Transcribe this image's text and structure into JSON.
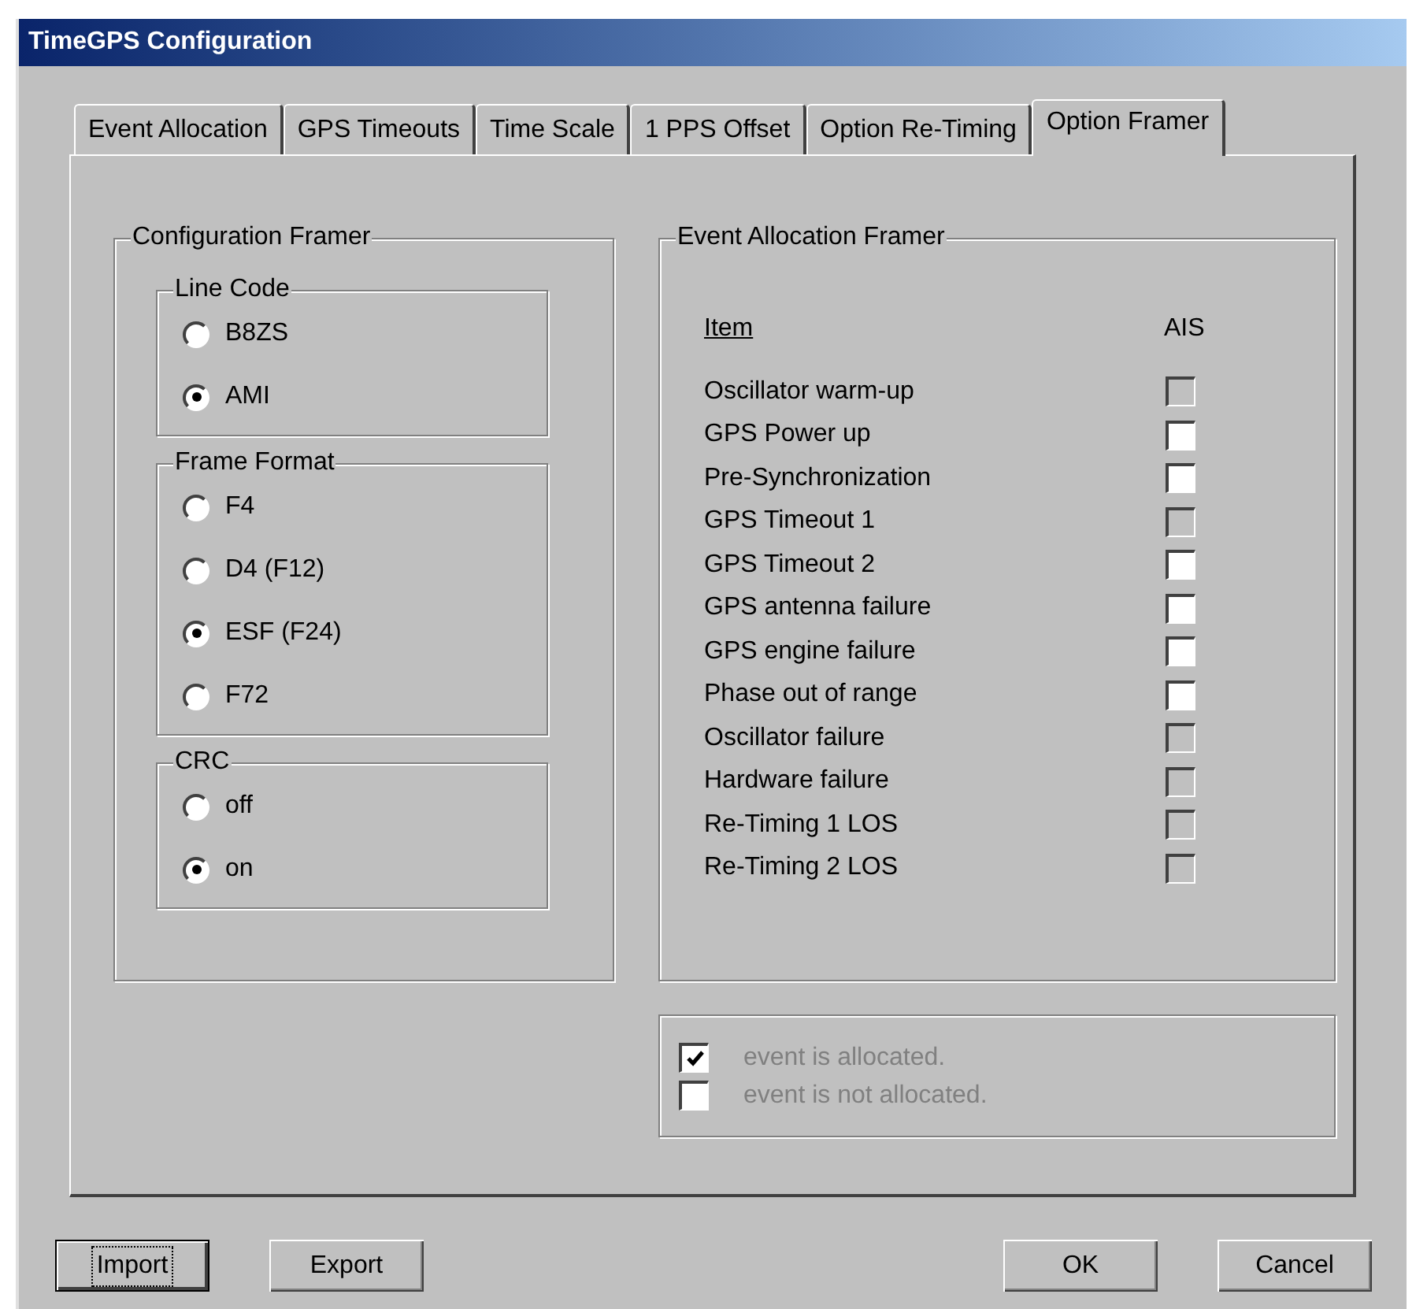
{
  "window": {
    "title": "TimeGPS Configuration"
  },
  "tabs": [
    {
      "label": "Event Allocation",
      "selected": false
    },
    {
      "label": "GPS Timeouts",
      "selected": false
    },
    {
      "label": "Time Scale",
      "selected": false
    },
    {
      "label": "1 PPS Offset",
      "selected": false
    },
    {
      "label": "Option Re-Timing",
      "selected": false
    },
    {
      "label": "Option Framer",
      "selected": true
    }
  ],
  "configuration_framer": {
    "title": "Configuration Framer",
    "groups": [
      {
        "title": "Line Code",
        "options": [
          {
            "label": "B8ZS",
            "selected": false
          },
          {
            "label": "AMI",
            "selected": true
          }
        ]
      },
      {
        "title": "Frame Format",
        "options": [
          {
            "label": "F4",
            "selected": false
          },
          {
            "label": "D4 (F12)",
            "selected": false
          },
          {
            "label": "ESF (F24)",
            "selected": true
          },
          {
            "label": "F72",
            "selected": false
          }
        ]
      },
      {
        "title": "CRC",
        "options": [
          {
            "label": "off",
            "selected": false
          },
          {
            "label": "on",
            "selected": true
          }
        ]
      }
    ]
  },
  "event_allocation_framer": {
    "title": "Event Allocation Framer",
    "columns": [
      "Item",
      "AIS"
    ],
    "items": [
      {
        "label": "Oscillator warm-up",
        "checked": false,
        "disabled": true
      },
      {
        "label": "GPS Power up",
        "checked": false,
        "disabled": false
      },
      {
        "label": "Pre-Synchronization",
        "checked": false,
        "disabled": false
      },
      {
        "label": "GPS Timeout 1",
        "checked": false,
        "disabled": true
      },
      {
        "label": "GPS Timeout 2",
        "checked": false,
        "disabled": false
      },
      {
        "label": "GPS antenna failure",
        "checked": false,
        "disabled": false
      },
      {
        "label": "GPS engine failure",
        "checked": false,
        "disabled": false
      },
      {
        "label": "Phase out of range",
        "checked": false,
        "disabled": false
      },
      {
        "label": "Oscillator failure",
        "checked": false,
        "disabled": true
      },
      {
        "label": "Hardware failure",
        "checked": false,
        "disabled": true
      },
      {
        "label": "Re-Timing 1 LOS",
        "checked": false,
        "disabled": true
      },
      {
        "label": "Re-Timing 2 LOS",
        "checked": false,
        "disabled": true
      }
    ]
  },
  "legend": [
    {
      "label": "event is allocated.",
      "checked": true,
      "disabled": false
    },
    {
      "label": "event is not allocated.",
      "checked": false,
      "disabled": false
    }
  ],
  "buttons_left": [
    {
      "label": "Import",
      "focused": true
    },
    {
      "label": "Export",
      "focused": false
    }
  ],
  "buttons_right": [
    {
      "label": "OK",
      "focused": false
    },
    {
      "label": "Cancel",
      "focused": false
    }
  ]
}
